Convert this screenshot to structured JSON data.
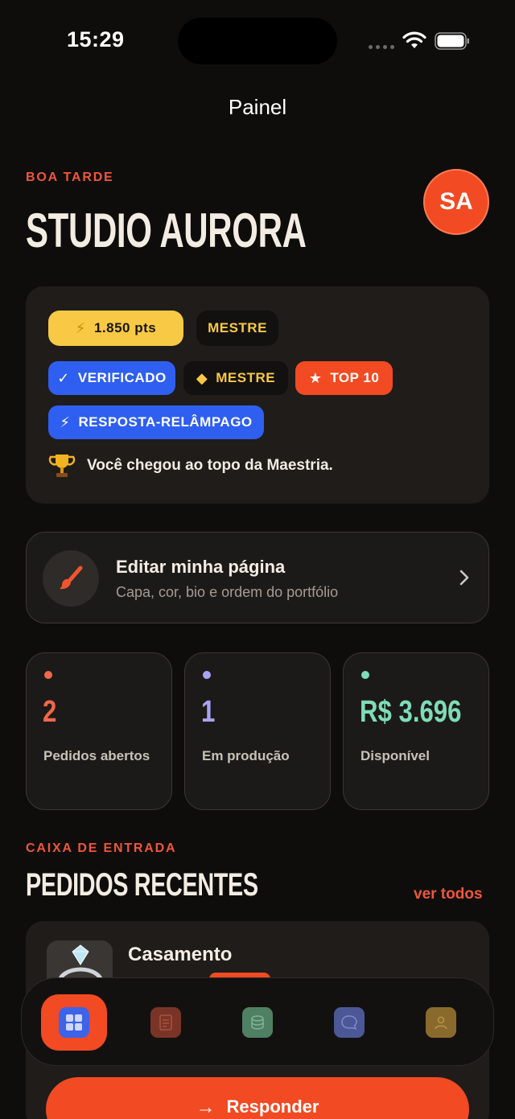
{
  "status": {
    "time": "15:29"
  },
  "nav": {
    "title": "Painel"
  },
  "greeting": {
    "eyebrow": "BOA TARDE",
    "studio_name": "STUDIO AURORA",
    "avatar_initials": "SA"
  },
  "badges": {
    "points": "1.850 pts",
    "level": "MESTRE",
    "verified": "VERIFICADO",
    "master": "MESTRE",
    "top": "TOP 10",
    "fast_reply": "RESPOSTA-RELÂMPAGO",
    "message": "Você chegou ao topo da Maestria."
  },
  "edit_page": {
    "title": "Editar minha página",
    "subtitle": "Capa, cor, bio e ordem do portfólio"
  },
  "stats": [
    {
      "value": "2",
      "label": "Pedidos abertos",
      "color": "#f0674a"
    },
    {
      "value": "1",
      "label": "Em produção",
      "color": "#a9a3f2"
    },
    {
      "value": "R$ 3.696",
      "label": "Disponível",
      "color": "#7fdcb6"
    }
  ],
  "inbox": {
    "eyebrow": "CAIXA DE ENTRADA",
    "title": "PEDIDOS RECENTES",
    "see_all": "ver todos"
  },
  "orders": [
    {
      "title": "Casamento"
    }
  ],
  "tabs": [
    {
      "icon": "grid-icon",
      "active": true,
      "color": "#3d63e8"
    },
    {
      "icon": "document-icon",
      "active": false,
      "color": "#7a3427"
    },
    {
      "icon": "coins-icon",
      "active": false,
      "color": "#4f8064"
    },
    {
      "icon": "chat-icon",
      "active": false,
      "color": "#4c5896"
    },
    {
      "icon": "profile-icon",
      "active": false,
      "color": "#8a6a2c"
    }
  ],
  "actions": {
    "respond": "Responder"
  },
  "colors": {
    "accent": "#f24a22",
    "background": "#0f0d0c",
    "card": "#1f1c1a"
  }
}
